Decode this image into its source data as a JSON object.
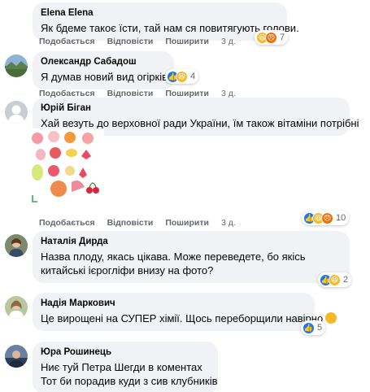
{
  "actions": {
    "like": "Подобається",
    "reply": "Відповісти",
    "share": "Поширити",
    "time": "3 д."
  },
  "comments": [
    {
      "author": "Elena Elena",
      "text": "Як бдеме такоє їсти, тай нам ся повитягують голови.",
      "reactions": [
        "haha",
        "angry"
      ],
      "reaction_count": "7"
    },
    {
      "author": "Олександр Сабадош",
      "text": "Я думав новий вид огірків..",
      "reactions": [
        "like",
        "haha"
      ],
      "reaction_count": "4"
    },
    {
      "author": "Юрій Біган",
      "text": "Хай везуть до верховної ради України, їм також вітаміни потрібні",
      "reactions": [
        "like",
        "haha",
        "angry"
      ],
      "reaction_count": "10"
    },
    {
      "author": "Наталія Дирда",
      "text": "Назва плоду, якась цікава. Може переведете, бо якісь китайські ієрогліфи внизу на фото?",
      "reactions": [
        "like",
        "haha"
      ],
      "reaction_count": "2"
    },
    {
      "author": "Надія Маркович",
      "text": "Це вирощені на СУПЕР хімії. Щось переборщили навірно",
      "reactions": [
        "like"
      ],
      "reaction_count": "5"
    },
    {
      "author": "Юра Рошинець",
      "text_line1": "Ниє туй Петра Шегди в коментах",
      "text_line2": "Тот би порадив куди з сив клубників"
    }
  ],
  "colors": {
    "bubble": "#f0f2f5",
    "meta": "#65676b",
    "like": "#1877f2",
    "haha": "#f7b928",
    "angry": "#e9710f"
  }
}
